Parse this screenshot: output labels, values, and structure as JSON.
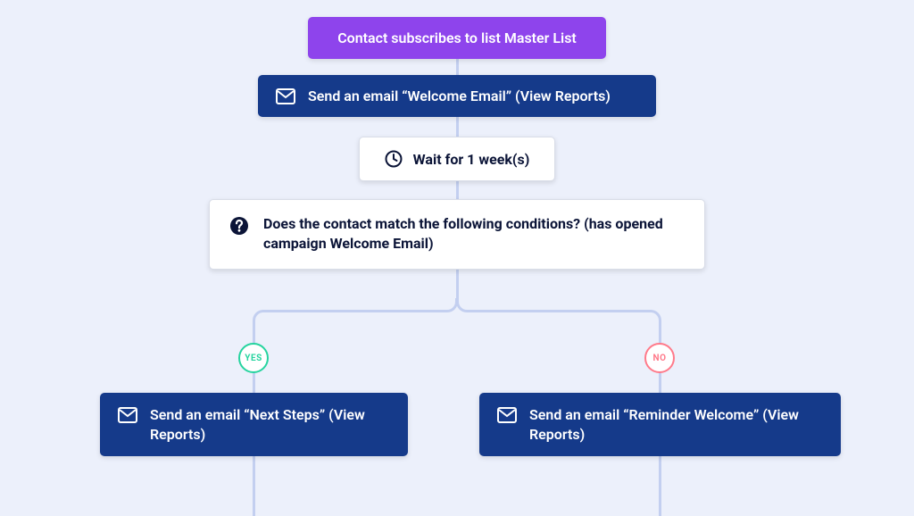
{
  "trigger": {
    "label": "Contact subscribes to list Master List"
  },
  "email1": {
    "label": "Send an email “Welcome Email” (View Reports)"
  },
  "wait": {
    "label": "Wait for 1 week(s)"
  },
  "condition": {
    "label": "Does the contact match the following conditions? (has opened campaign Welcome Email)"
  },
  "branch": {
    "yes_label": "YES",
    "no_label": "NO",
    "yes_email": {
      "label": "Send an email “Next Steps” (View Reports)"
    },
    "no_email": {
      "label": "Send an email “Reminder Welcome” (View Reports)"
    }
  }
}
